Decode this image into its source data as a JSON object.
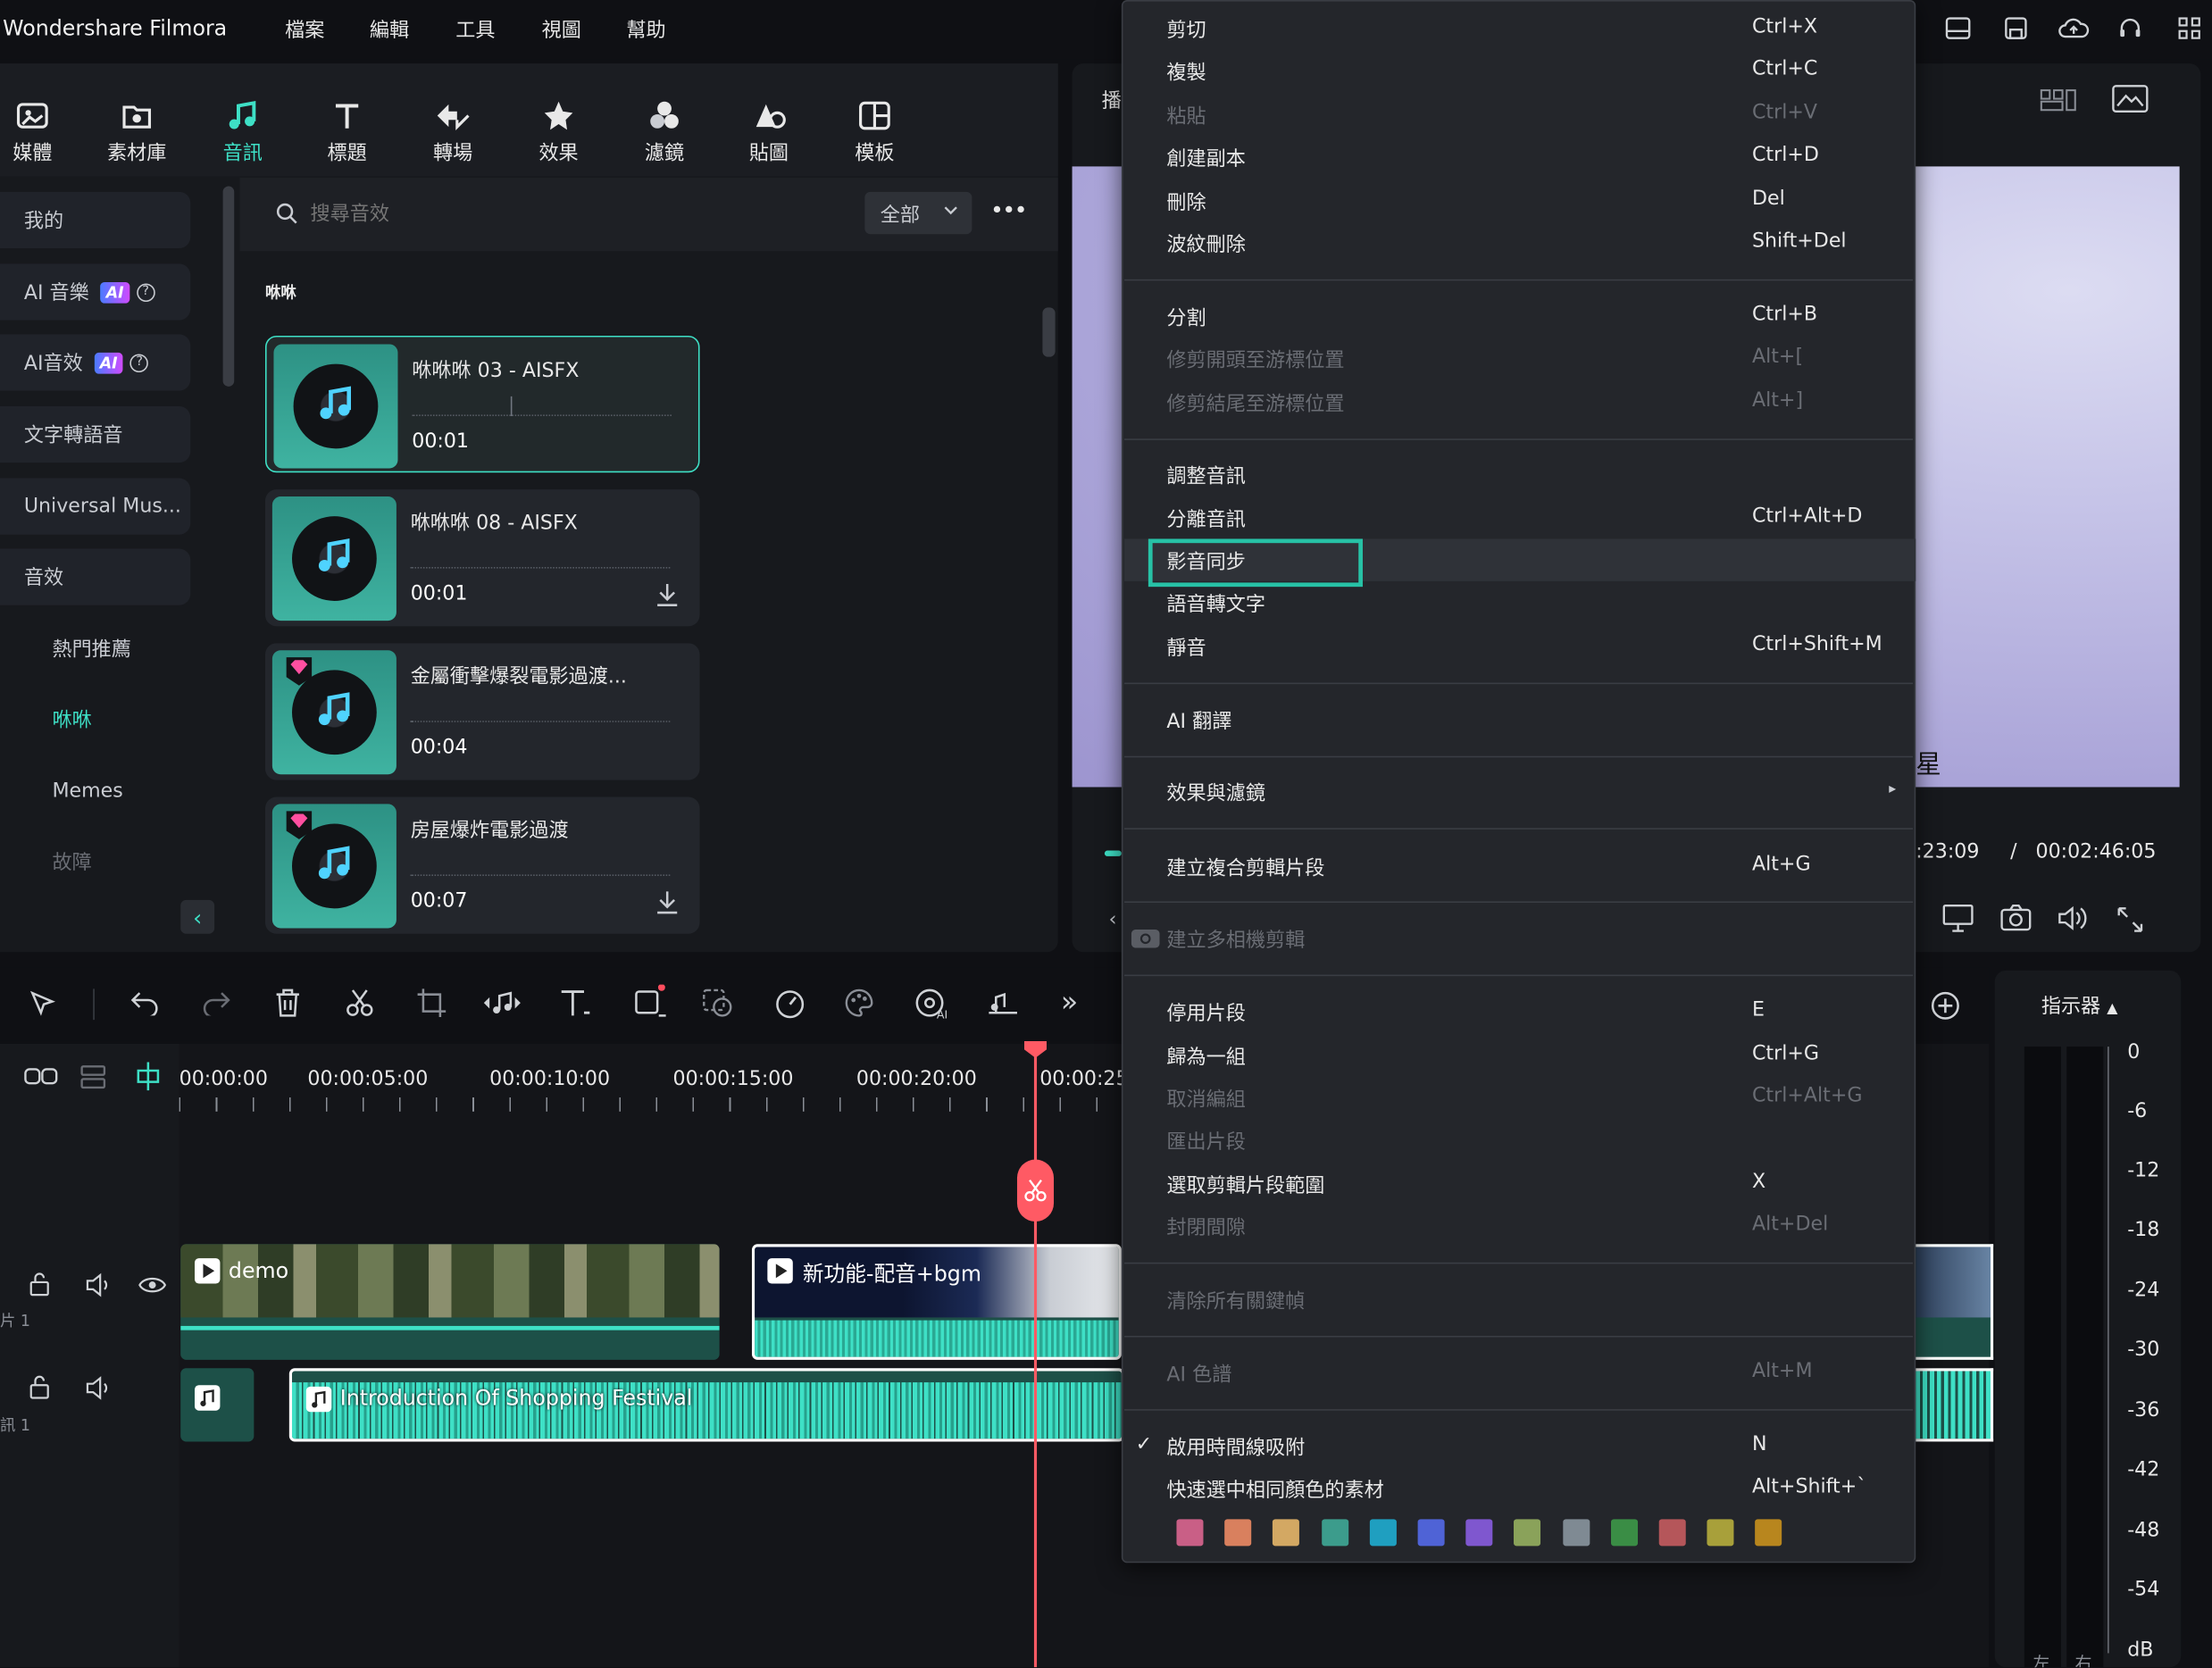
{
  "app": {
    "title": "Wondershare Filmora"
  },
  "menubar": [
    "檔案",
    "編輯",
    "工具",
    "視圖",
    "幫助"
  ],
  "toolbar": [
    {
      "label": "媒體",
      "icon": "media-icon"
    },
    {
      "label": "素材庫",
      "icon": "stock-icon"
    },
    {
      "label": "音訊",
      "icon": "music-note-icon",
      "active": true
    },
    {
      "label": "標題",
      "icon": "title-t-icon"
    },
    {
      "label": "轉場",
      "icon": "transition-icon"
    },
    {
      "label": "效果",
      "icon": "effects-star-icon"
    },
    {
      "label": "濾鏡",
      "icon": "filters-icon"
    },
    {
      "label": "貼圖",
      "icon": "sticker-icon"
    },
    {
      "label": "模板",
      "icon": "template-icon"
    }
  ],
  "sidebar": {
    "items": [
      {
        "label": "我的"
      },
      {
        "label": "AI 音樂",
        "badge": "AI"
      },
      {
        "label": "AI音效",
        "badge": "AI"
      },
      {
        "label": "文字轉語音"
      },
      {
        "label": "Universal Mus..."
      },
      {
        "label": "音效"
      },
      {
        "label": "熱門推薦"
      },
      {
        "label": "咻咻"
      },
      {
        "label": "Memes"
      },
      {
        "label": "故障"
      }
    ],
    "collapse": "‹"
  },
  "search": {
    "placeholder": "搜尋音效",
    "filter": "全部",
    "more": "•••"
  },
  "section_title": "咻咻",
  "cards": [
    {
      "name": "咻咻咻 03 - AISFX",
      "duration": "00:01"
    },
    {
      "name": "咻咻咻 08 - AISFX",
      "duration": "00:01"
    },
    {
      "name": "金屬衝擊爆裂電影過渡...",
      "duration": "00:04"
    },
    {
      "name": "房屋爆炸電影過渡",
      "duration": "00:07"
    }
  ],
  "preview": {
    "tab_label": "播",
    "subtitle_char": "星",
    "time_current": ":23:09",
    "time_sep": "/",
    "time_total": "00:02:46:05"
  },
  "context_menu": {
    "items": [
      {
        "label": "剪切",
        "shortcut": "Ctrl+X"
      },
      {
        "label": "複製",
        "shortcut": "Ctrl+C"
      },
      {
        "label": "粘貼",
        "shortcut": "Ctrl+V",
        "disabled": true
      },
      {
        "label": "創建副本",
        "shortcut": "Ctrl+D"
      },
      {
        "label": "刪除",
        "shortcut": "Del"
      },
      {
        "label": "波紋刪除",
        "shortcut": "Shift+Del"
      },
      {
        "label": "分割",
        "shortcut": "Ctrl+B"
      },
      {
        "label": "修剪開頭至游標位置",
        "shortcut": "Alt+[",
        "disabled": true
      },
      {
        "label": "修剪結尾至游標位置",
        "shortcut": "Alt+]",
        "disabled": true
      },
      {
        "label": "調整音訊",
        "shortcut": ""
      },
      {
        "label": "分離音訊",
        "shortcut": "Ctrl+Alt+D"
      },
      {
        "label": "影音同步",
        "shortcut": "",
        "highlighted": true
      },
      {
        "label": "語音轉文字",
        "shortcut": ""
      },
      {
        "label": "靜音",
        "shortcut": "Ctrl+Shift+M"
      },
      {
        "label": "AI 翻譯",
        "shortcut": ""
      },
      {
        "label": "效果與濾鏡",
        "shortcut": "",
        "submenu": true
      },
      {
        "label": "建立複合剪輯片段",
        "shortcut": "Alt+G"
      },
      {
        "label": "建立多相機剪輯",
        "shortcut": "",
        "disabled": true
      },
      {
        "label": "停用片段",
        "shortcut": "E"
      },
      {
        "label": "歸為一組",
        "shortcut": "Ctrl+G"
      },
      {
        "label": "取消編組",
        "shortcut": "Ctrl+Alt+G",
        "disabled": true
      },
      {
        "label": "匯出片段",
        "shortcut": "",
        "disabled": true
      },
      {
        "label": "選取剪輯片段範圍",
        "shortcut": "X"
      },
      {
        "label": "封閉間隙",
        "shortcut": "Alt+Del",
        "disabled": true
      },
      {
        "label": "清除所有關鍵幀",
        "shortcut": "",
        "disabled": true
      },
      {
        "label": "AI 色譜",
        "shortcut": "Alt+M",
        "disabled": true
      },
      {
        "label": "啟用時間線吸附",
        "shortcut": "N",
        "checked": true
      },
      {
        "label": "快速選中相同顏色的素材",
        "shortcut": "Alt+Shift+`"
      }
    ],
    "swatches": [
      "#c95f86",
      "#d9805e",
      "#d3a863",
      "#3c9c8c",
      "#1f9fc0",
      "#4f63d6",
      "#7f57cf",
      "#8aa25a",
      "#7f8a93",
      "#3a8d45",
      "#b5565a",
      "#a8a03a",
      "#b8861e"
    ],
    "submenu_arrow": "▸",
    "check": "✓"
  },
  "timeline": {
    "ruler": [
      "00:00:00",
      "00:00:05:00",
      "00:00:10:00",
      "00:00:15:00",
      "00:00:20:00",
      "00:00:25"
    ],
    "video_clip_1": "demo",
    "video_clip_2": "新功能-配音+bgm",
    "audio_clip": "Introduction Of Shopping Festival",
    "track1_label": "片 1",
    "track2_label": "訊 1",
    "more_tools": "»"
  },
  "meter": {
    "title": "指示器",
    "scale": [
      "0",
      "-6",
      "-12",
      "-18",
      "-24",
      "-30",
      "-36",
      "-42",
      "-48",
      "-54",
      "dB"
    ],
    "lr": "左 右"
  }
}
